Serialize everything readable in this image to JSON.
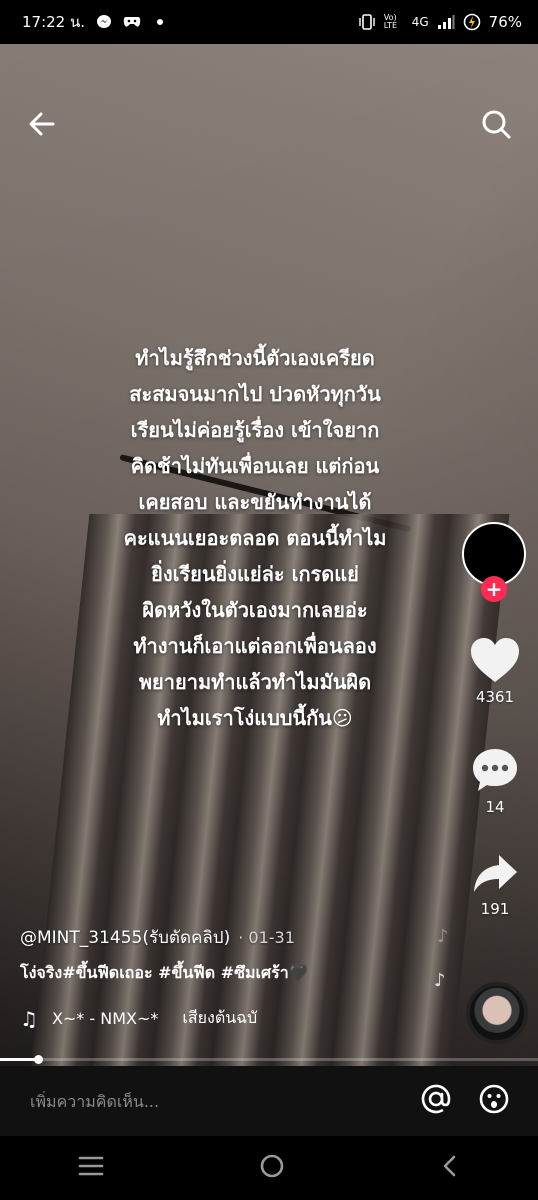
{
  "status": {
    "time": "17:22 น.",
    "network": "4G",
    "battery": "76%",
    "volte": "Vo) LTE"
  },
  "video": {
    "overlay_text": "ทำไมรู้สึกช่วงนี้ตัวเองเครียด\nสะสมจนมากไป ปวดหัวทุกวัน\nเรียนไม่ค่อยรู้เรื่อง เข้าใจยาก\nคิดช้าไม่ทันเพื่อนเลย แต่ก่อน\nเคยสอบ และขยันทำงานได้\nคะแนนเยอะตลอด ตอนนี้ทำไม\nยิ่งเรียนยิ่งแย่ล่ะ เกรดแย่\nผิดหวังในตัวเองมากเลยอ่ะ\nทำงานก็เอาแต่ลอกเพื่อนลอง\nพยายามทำแล้วทำไมมันผิด\nทำไมเราโง่แบบนี้กัน😕"
  },
  "rail": {
    "likes": "4361",
    "comments": "14",
    "shares": "191",
    "follow_symbol": "+"
  },
  "info": {
    "author": "@MINT_31455(รับตัดคลิป)",
    "date": "· 01-31",
    "caption": "โง่จริง#ขึ้นฟีดเถอะ #ขึ้นฟีด #ซึมเศร้า🖤",
    "music_title": "X~* - NMX~*",
    "music_source": "เสียงต้นฉบั"
  },
  "comment_bar": {
    "placeholder": "เพิ่มความคิดเห็น..."
  },
  "colors": {
    "accent": "#fe2c55",
    "background": "#000000"
  },
  "progress": 0.07
}
